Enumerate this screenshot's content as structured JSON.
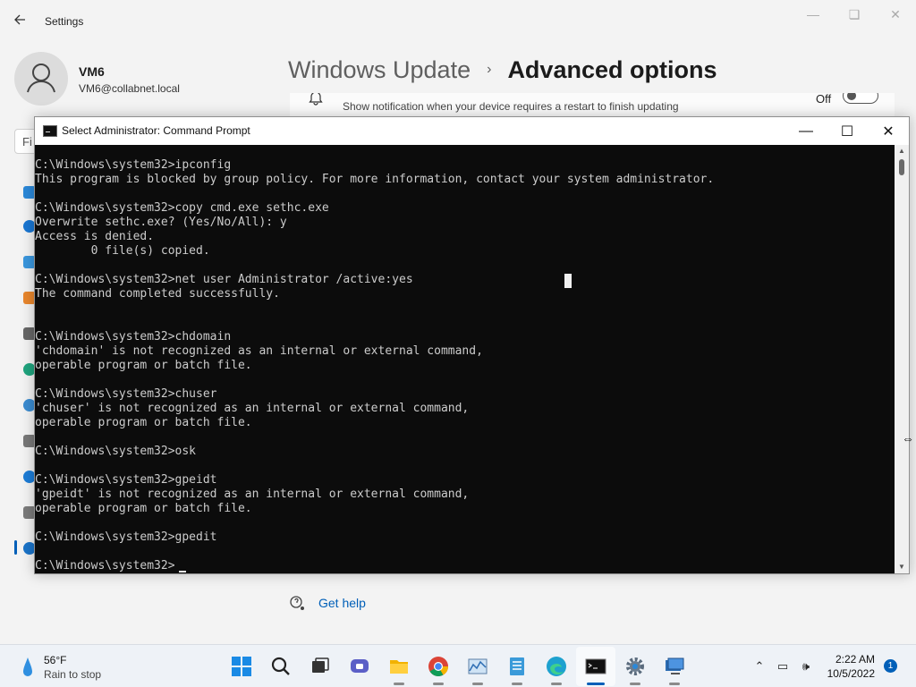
{
  "settings": {
    "app_title": "Settings",
    "user": {
      "name": "VM6",
      "email": "VM6@collabnet.local"
    },
    "breadcrumb": {
      "parent": "Windows Update",
      "separator": "›",
      "current": "Advanced options"
    },
    "notify_restart": {
      "description": "Show notification when your device requires a restart to finish updating",
      "toggle_label": "Off"
    },
    "find_placeholder": "Fi",
    "get_help": "Get help"
  },
  "cmd": {
    "title": "Select Administrator: Command Prompt",
    "lines": [
      "C:\\Windows\\system32>ipconfig",
      "This program is blocked by group policy. For more information, contact your system administrator.",
      "",
      "C:\\Windows\\system32>copy cmd.exe sethc.exe",
      "Overwrite sethc.exe? (Yes/No/All): y",
      "Access is denied.",
      "        0 file(s) copied.",
      "",
      "C:\\Windows\\system32>net user Administrator /active:yes",
      "The command completed successfully.",
      "",
      "",
      "C:\\Windows\\system32>chdomain",
      "'chdomain' is not recognized as an internal or external command,",
      "operable program or batch file.",
      "",
      "C:\\Windows\\system32>chuser",
      "'chuser' is not recognized as an internal or external command,",
      "operable program or batch file.",
      "",
      "C:\\Windows\\system32>osk",
      "",
      "C:\\Windows\\system32>gpeidt",
      "'gpeidt' is not recognized as an internal or external command,",
      "operable program or batch file.",
      "",
      "C:\\Windows\\system32>gpedit",
      "",
      "C:\\Windows\\system32>"
    ]
  },
  "taskbar": {
    "weather": {
      "temp": "56°F",
      "condition": "Rain to stop"
    },
    "apps": [
      {
        "name": "start-icon"
      },
      {
        "name": "search-icon"
      },
      {
        "name": "task-view-icon"
      },
      {
        "name": "teams-chat-icon"
      },
      {
        "name": "file-explorer-icon"
      },
      {
        "name": "chrome-icon"
      },
      {
        "name": "resource-monitor-icon"
      },
      {
        "name": "notepad-icon"
      },
      {
        "name": "edge-icon"
      },
      {
        "name": "command-prompt-icon",
        "active": true
      },
      {
        "name": "settings-gear-icon"
      },
      {
        "name": "remote-desktop-icon"
      }
    ],
    "clock": {
      "time": "2:22 AM",
      "date": "10/5/2022"
    },
    "notification_count": "1"
  },
  "colors": {
    "accent": "#005fb8",
    "console_bg": "#0c0c0c",
    "console_text": "#cccccc"
  }
}
